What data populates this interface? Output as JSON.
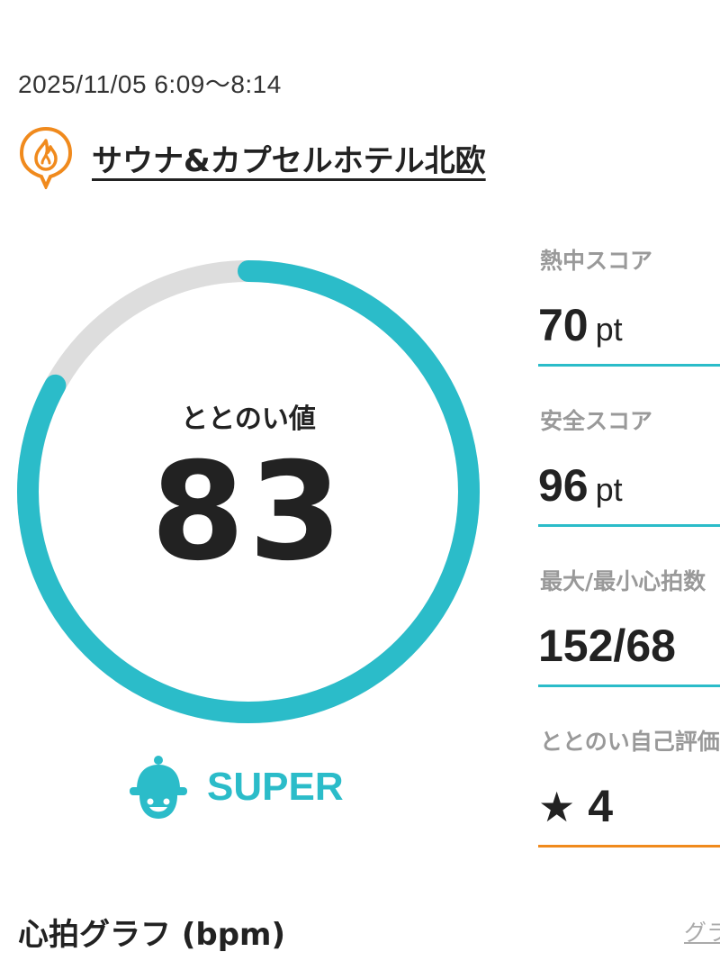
{
  "session": {
    "datetime": "2025/11/05 6:09〜8:14",
    "facility_name": "サウナ&カプセルホテル北欧",
    "facility_icon": "sauna-fire-pin-icon"
  },
  "gauge": {
    "label": "ととのい値",
    "value": "83",
    "percent": 83,
    "track_color": "#dddddd",
    "fill_color": "#2bbcc9"
  },
  "level": {
    "label": "SUPER",
    "icon": "sauna-hat-face-icon",
    "color": "#2bbcc9"
  },
  "stats": [
    {
      "label": "熱中スコア",
      "value": "70",
      "unit": "pt"
    },
    {
      "label": "安全スコア",
      "value": "96",
      "unit": "pt"
    },
    {
      "label": "最大/最小心拍数",
      "value": "152/68",
      "unit": ""
    },
    {
      "label": "ととのい自己評価",
      "value": "4",
      "icon": "star-icon"
    }
  ],
  "graph": {
    "title": "心拍グラフ (bpm)",
    "link_label": "グラフ"
  },
  "colors": {
    "accent": "#2bbcc9",
    "orange": "#f08a1d"
  }
}
